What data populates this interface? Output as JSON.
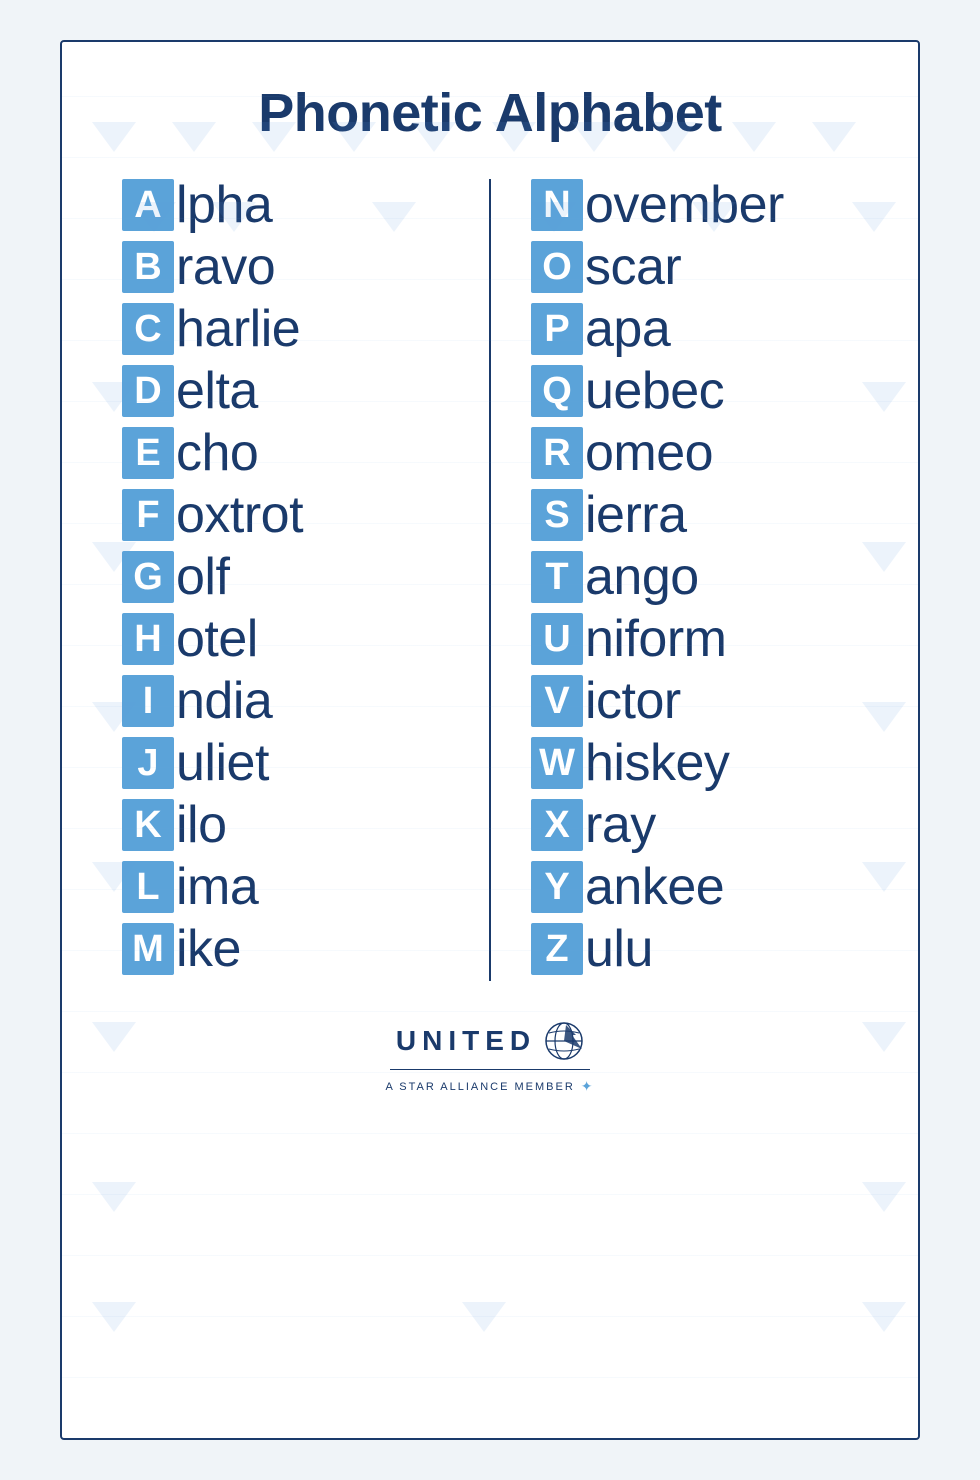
{
  "page": {
    "title": "Phonetic Alphabet"
  },
  "left_column": [
    {
      "letter": "A",
      "rest": "lpha"
    },
    {
      "letter": "B",
      "rest": "ravo"
    },
    {
      "letter": "C",
      "rest": "harlie"
    },
    {
      "letter": "D",
      "rest": "elta"
    },
    {
      "letter": "E",
      "rest": "cho"
    },
    {
      "letter": "F",
      "rest": "oxtrot"
    },
    {
      "letter": "G",
      "rest": "olf"
    },
    {
      "letter": "H",
      "rest": "otel"
    },
    {
      "letter": "I",
      "rest": "ndia"
    },
    {
      "letter": "J",
      "rest": "uliet"
    },
    {
      "letter": "K",
      "rest": "ilo"
    },
    {
      "letter": "L",
      "rest": "ima"
    },
    {
      "letter": "M",
      "rest": "ike"
    }
  ],
  "right_column": [
    {
      "letter": "N",
      "rest": "ovember"
    },
    {
      "letter": "O",
      "rest": "scar"
    },
    {
      "letter": "P",
      "rest": "apa"
    },
    {
      "letter": "Q",
      "rest": "uebec"
    },
    {
      "letter": "R",
      "rest": "omeo"
    },
    {
      "letter": "S",
      "rest": "ierra"
    },
    {
      "letter": "T",
      "rest": "ango"
    },
    {
      "letter": "U",
      "rest": "niform"
    },
    {
      "letter": "V",
      "rest": "ictor"
    },
    {
      "letter": "W",
      "rest": "hiskey"
    },
    {
      "letter": "X",
      "rest": "ray"
    },
    {
      "letter": "Y",
      "rest": "ankee"
    },
    {
      "letter": "Z",
      "rest": "ulu"
    }
  ],
  "footer": {
    "brand": "UNITED",
    "tagline": "A STAR ALLIANCE MEMBER"
  },
  "colors": {
    "primary": "#1a3a6b",
    "accent": "#5ba3d9"
  }
}
